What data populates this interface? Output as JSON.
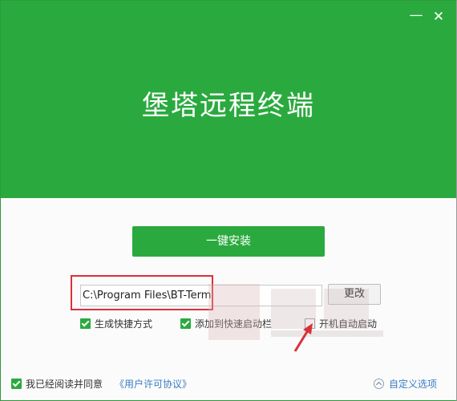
{
  "window": {
    "title": "堡塔远程终端",
    "minimize_label": "—",
    "close_label": "✕"
  },
  "install": {
    "button_label": "一键安装"
  },
  "path": {
    "value": "C:\\Program Files\\BT-Term",
    "change_label": "更改"
  },
  "options": [
    {
      "label": "生成快捷方式",
      "checked": true
    },
    {
      "label": "添加到快速启动栏",
      "checked": true
    },
    {
      "label": "开机自动启动",
      "checked": false
    }
  ],
  "footer": {
    "agree_label": "我已经阅读并同意",
    "agree_checked": true,
    "agreement_link": "《用户许可协议》",
    "custom_options_label": "自定义选项"
  },
  "colors": {
    "brand_green": "#2aaa3e",
    "link_blue": "#3a7cc4",
    "highlight_red": "#d8323a"
  }
}
